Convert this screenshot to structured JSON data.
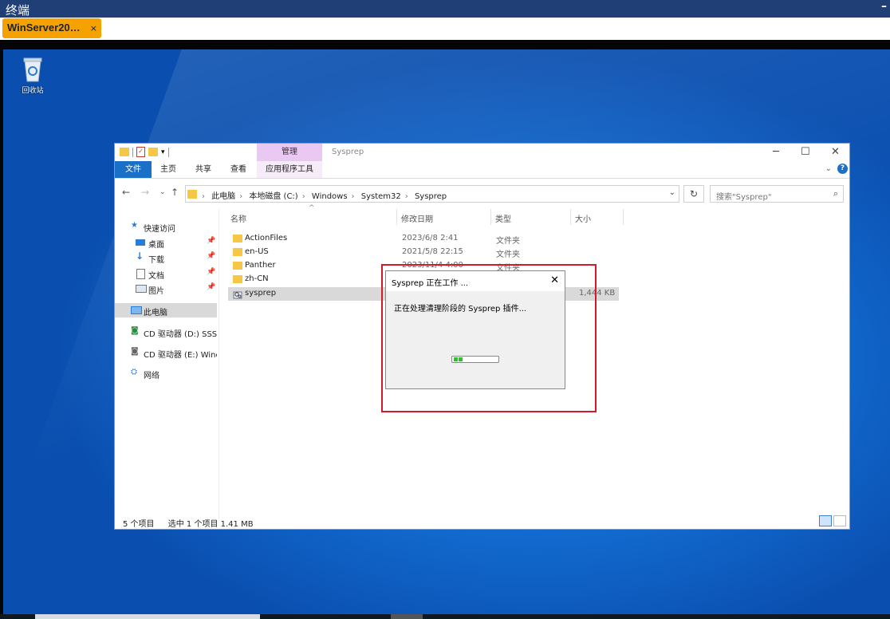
{
  "app": {
    "title": "终端",
    "tab_label": "WinServer20…",
    "tab_close": "×",
    "minimize_glyph": "–"
  },
  "desktop": {
    "recycle_bin_label": "回收站"
  },
  "explorer": {
    "context_tab": "管理",
    "window_title": "Sysprep",
    "ribbon_tabs": [
      "文件",
      "主页",
      "共享",
      "查看",
      "应用程序工具"
    ],
    "address_crumbs": [
      "此电脑",
      "本地磁盘 (C:)",
      "Windows",
      "System32",
      "Sysprep"
    ],
    "search_placeholder": "搜索\"Sysprep\"",
    "nav_items": [
      {
        "label": "快速访问",
        "icon": "star-icon"
      },
      {
        "label": "桌面",
        "icon": "desktop-icon",
        "pinned": true
      },
      {
        "label": "下载",
        "icon": "download-icon",
        "pinned": true
      },
      {
        "label": "文档",
        "icon": "document-icon",
        "pinned": true
      },
      {
        "label": "图片",
        "icon": "pictures-icon",
        "pinned": true
      },
      {
        "label": "此电脑",
        "icon": "computer-icon",
        "selected": true
      },
      {
        "label": "CD 驱动器 (D:) SSS_",
        "icon": "cd-drive-icon"
      },
      {
        "label": "CD 驱动器 (E:) Winc",
        "icon": "cd-drive-icon"
      },
      {
        "label": "网络",
        "icon": "network-icon"
      }
    ],
    "columns": [
      "名称",
      "修改日期",
      "类型",
      "大小"
    ],
    "files": [
      {
        "name": "ActionFiles",
        "date": "2023/6/8 2:41",
        "type": "文件夹",
        "size": ""
      },
      {
        "name": "en-US",
        "date": "2021/5/8 22:15",
        "type": "文件夹",
        "size": ""
      },
      {
        "name": "Panther",
        "date": "2023/11/4 4:00",
        "type": "文件夹",
        "size": ""
      },
      {
        "name": "zh-CN",
        "date": "",
        "type": "",
        "size": ""
      },
      {
        "name": "sysprep",
        "date": "",
        "type": "",
        "size": "1,444 KB",
        "selected": true
      }
    ],
    "status": {
      "item_count": "5 个项目",
      "selection": "选中 1 个项目  1.41 MB"
    }
  },
  "dialog": {
    "title": "Sysprep 正在工作 ...",
    "message": "正在处理清理阶段的 Sysprep 插件...",
    "close_glyph": "✕",
    "progress_blocks_lit": 2
  },
  "colors": {
    "titlebar": "#1f3f76",
    "tab": "#f5a100",
    "file_tab": "#1a6fc7",
    "context_tab": "#e9c9f2",
    "highlight_box": "#d01c2a",
    "progress": "#23c623"
  }
}
